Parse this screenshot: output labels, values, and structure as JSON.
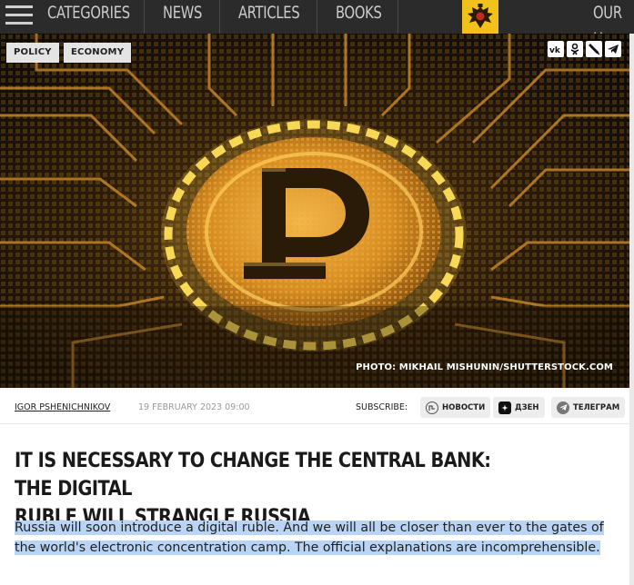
{
  "nav": {
    "items": [
      "CATEGORIES",
      "NEWS",
      "ARTICLES",
      "BOOKS"
    ],
    "right_label": "OUR H",
    "accent": "#f1c21b"
  },
  "hero": {
    "tags": [
      "POLICY",
      "ECONOMY"
    ],
    "share_icons": [
      "vk-icon",
      "odnoklassniki-icon",
      "livejournal-icon",
      "telegram-icon"
    ],
    "photo_credit": "PHOTO: MIKHAIL MISHUNIN/SHUTTERSTOCK.COM",
    "image_subject": "golden-ruble-coin-circuit"
  },
  "meta": {
    "author": "IGOR PSHENICHNIKOV",
    "date": "19 FEBRUARY 2023 09:00",
    "subscribe_label": "SUBSCRIBE:",
    "channels": [
      {
        "label": "НОВОСТИ",
        "icon": "news-icon"
      },
      {
        "label": "ДЗЕН",
        "icon": "dzen-icon"
      },
      {
        "label": "ТЕЛЕГРАМ",
        "icon": "telegram-icon"
      }
    ]
  },
  "article": {
    "title_line1": "IT IS NECESSARY TO CHANGE THE CENTRAL BANK: THE DIGITAL",
    "title_line2": "RUBLE WILL STRANGLE RUSSIA",
    "lead": "Russia will soon introduce a digital ruble. And we will all be closer than ever to the gates of the world's electronic concentration camp. The official explanations are incomprehensible.",
    "selection_color": "#b9d4f4"
  }
}
